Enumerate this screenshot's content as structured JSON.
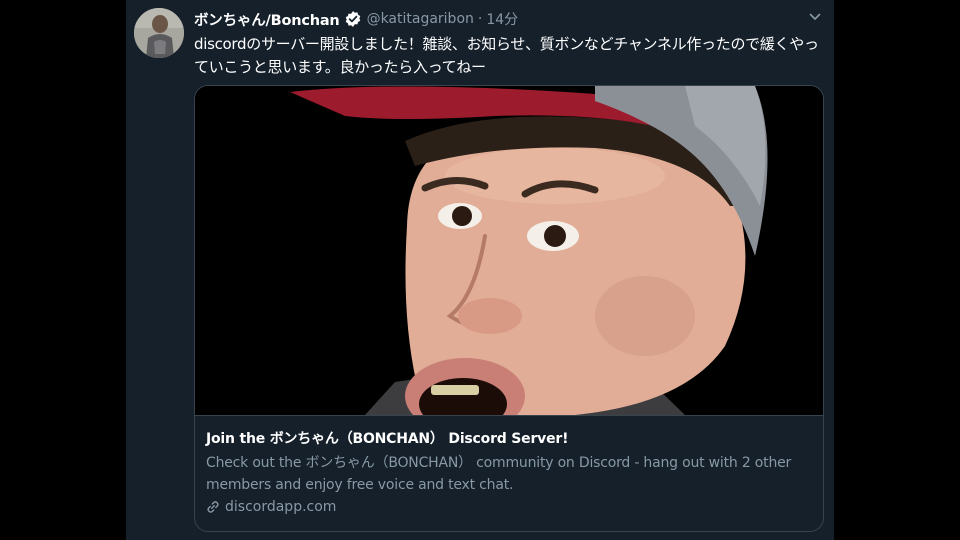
{
  "tweet": {
    "author": {
      "display_name": "ボンちゃん/Bonchan",
      "handle": "@katitagaribon",
      "verified": true,
      "avatar_icon": "profile-photo"
    },
    "separator": "·",
    "timestamp": "14分",
    "menu_icon": "chevron-down-icon",
    "text": "discordのサーバー開設しました！雑談、お知らせ、質ボンなどチャンネル作ったので緩くやっていこうと思います。良かったら入ってねー",
    "card": {
      "image_alt": "close-up face photo",
      "title": "Join the ボンちゃん（BONCHAN） Discord Server!",
      "description": "Check out the ボンちゃん（BONCHAN） community on Discord - hang out with 2 other members and enjoy free voice and text chat.",
      "domain": "discordapp.com",
      "link_icon": "link-icon"
    }
  },
  "colors": {
    "background": "#15202b",
    "border": "#38444d",
    "secondary_text": "#8899a6",
    "verified": "#ffffff"
  }
}
